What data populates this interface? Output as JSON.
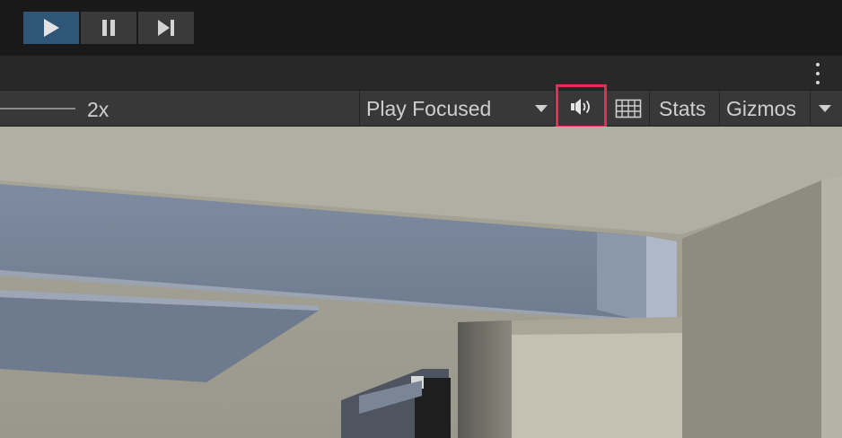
{
  "play_controls": {
    "play_icon": "play-icon",
    "pause_icon": "pause-icon",
    "step_icon": "step-forward-icon",
    "play_active_color": "#2f5577"
  },
  "tab_strip": {
    "menu_icon": "kebab-menu-icon"
  },
  "game_toolbar": {
    "scale_label": "2x",
    "play_mode_selected": "Play Focused",
    "mute_icon": "speaker-icon",
    "mute_highlight_color": "#e0305a",
    "keyboard_icon": "keyboard-icon",
    "stats_label": "Stats",
    "gizmos_label": "Gizmos"
  },
  "viewport": {
    "scene": "3d-interior-ceiling-beam"
  }
}
